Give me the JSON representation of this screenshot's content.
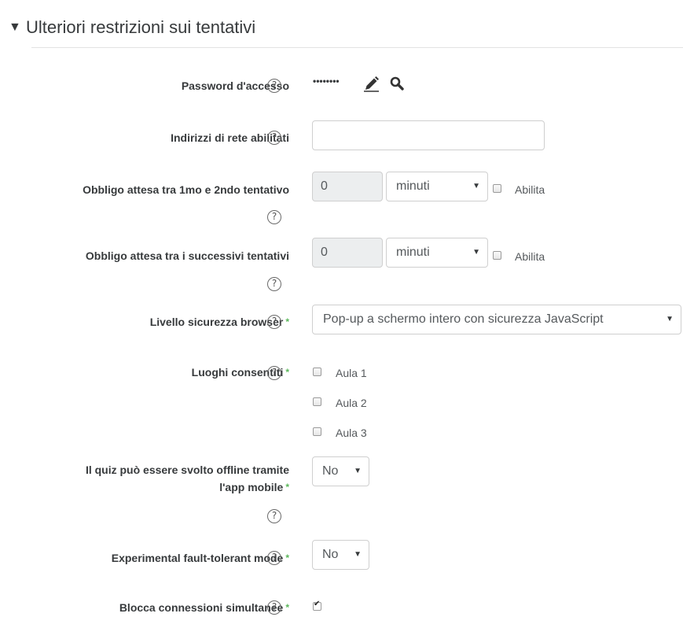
{
  "section": {
    "toggle_icon": "triangle-down-icon",
    "toggle_glyph": "▼",
    "title": "Ulteriori restrizioni sui tentativi"
  },
  "help_glyph": "?",
  "password": {
    "label": "Password d'accesso",
    "masked_value": "••••••••",
    "edit_icon": "pencil-icon",
    "reveal_icon": "magnifier-icon"
  },
  "subnet": {
    "label": "Indirizzi di rete abilitati",
    "value": ""
  },
  "delay1": {
    "label": "Obbligo attesa tra 1mo e 2ndo tentativo",
    "value": "0",
    "unit": "minuti",
    "enable_label": "Abilita"
  },
  "delay2": {
    "label": "Obbligo attesa tra i successivi tentativi",
    "value": "0",
    "unit": "minuti",
    "enable_label": "Abilita"
  },
  "browser_security": {
    "label": "Livello sicurezza browser",
    "value": "Pop-up a schermo intero con sicurezza JavaScript"
  },
  "locations": {
    "label": "Luoghi consentiti",
    "options": [
      "Aula 1",
      "Aula 2",
      "Aula 3"
    ]
  },
  "offline": {
    "label_line1": "Il quiz può essere svolto offline tramite",
    "label_line2": "l'app mobile",
    "value": "No"
  },
  "fault_tolerant": {
    "label": "Experimental fault-tolerant mode",
    "value": "No"
  },
  "block_concurrent": {
    "label": "Blocca connessioni simultanee",
    "checked": true
  },
  "required_marker": "*",
  "dropdown_arrow": "▼"
}
